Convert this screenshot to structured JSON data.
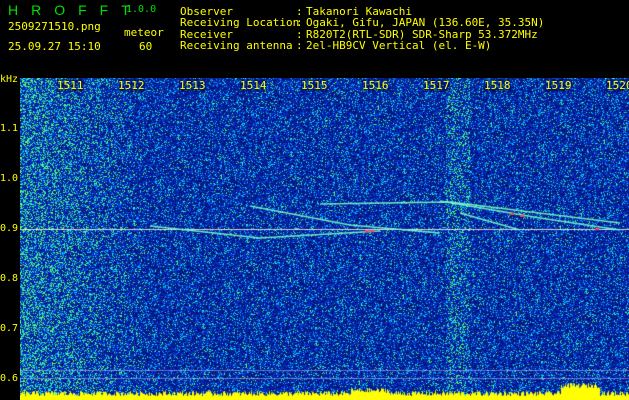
{
  "header": {
    "app_name": "HROFFT",
    "version": "1.0.0",
    "filename": "2509271510.png",
    "datetime": "25.09.27 15:10",
    "mode_label": "meteor",
    "mode_value": "60"
  },
  "info": [
    {
      "label": "Observer",
      "value": "Takanori Kawachi"
    },
    {
      "label": "Receiving Location",
      "value": "Ogaki, Gifu, JAPAN (136.60E, 35.35N)"
    },
    {
      "label": "Receiver",
      "value": "R820T2(RTL-SDR) SDR-Sharp 53.372MHz"
    },
    {
      "label": "Receiving antenna",
      "value": "2el-HB9CV Vertical (el. E-W)"
    }
  ],
  "separator": ":",
  "axis": {
    "y_unit": "kHz",
    "y_labels": [
      "1.1",
      "1.0",
      "0.9",
      "0.8",
      "0.7",
      "0.6"
    ],
    "x_labels": [
      "1511",
      "1512",
      "1513",
      "1514",
      "1515",
      "1516",
      "1517",
      "1518",
      "1519",
      "1520"
    ]
  },
  "colors": {
    "text": "#ffff00",
    "logo": "#00e000",
    "noise_base": "#0a1a8c"
  }
}
